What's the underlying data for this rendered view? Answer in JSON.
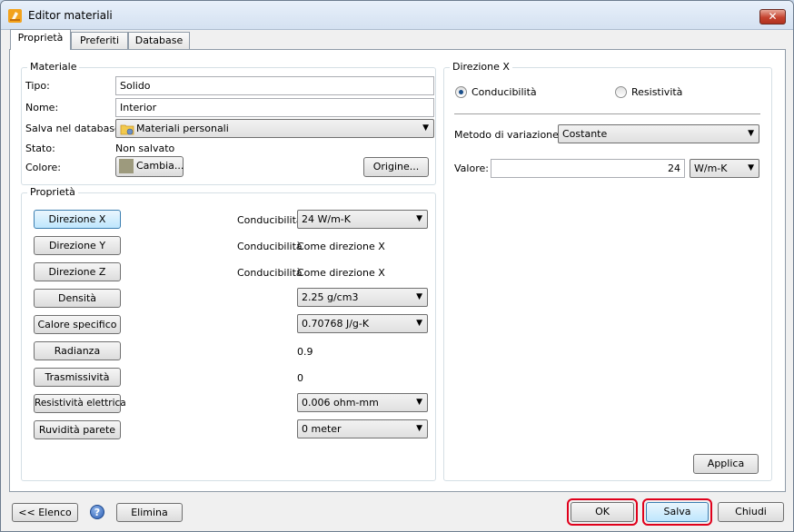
{
  "window": {
    "title": "Editor materiali",
    "close_label": "✕"
  },
  "tabs": [
    {
      "label": "Proprietà",
      "active": true
    },
    {
      "label": "Preferiti",
      "active": false
    },
    {
      "label": "Database",
      "active": false
    }
  ],
  "materiale": {
    "group_title": "Materiale",
    "tipo_label": "Tipo:",
    "tipo_value": "Solido",
    "nome_label": "Nome:",
    "nome_value": "Interior",
    "database_label": "Salva nel database:",
    "database_value": "Materiali personali",
    "stato_label": "Stato:",
    "stato_value": "Non salvato",
    "colore_label": "Colore:",
    "cambia_label": "Cambia...",
    "swatch_color": "#9d9a7d",
    "origine_label": "Origine..."
  },
  "proprieta": {
    "group_title": "Proprietà",
    "rows": [
      {
        "button": "Direzione X",
        "selected": true,
        "caption": "Conducibilità",
        "value": "24 W/m-K",
        "kind": "combo"
      },
      {
        "button": "Direzione Y",
        "selected": false,
        "caption": "Conducibilità",
        "value": "Come direzione X",
        "kind": "text"
      },
      {
        "button": "Direzione Z",
        "selected": false,
        "caption": "Conducibilità",
        "value": "Come direzione X",
        "kind": "text"
      },
      {
        "button": "Densità",
        "selected": false,
        "caption": "",
        "value": "2.25 g/cm3",
        "kind": "combo"
      },
      {
        "button": "Calore specifico",
        "selected": false,
        "caption": "",
        "value": "0.70768 J/g-K",
        "kind": "combo"
      },
      {
        "button": "Radianza",
        "selected": false,
        "caption": "",
        "value": "0.9",
        "kind": "text"
      },
      {
        "button": "Trasmissività",
        "selected": false,
        "caption": "",
        "value": "0",
        "kind": "text"
      },
      {
        "button": "Resistività elettrica",
        "selected": false,
        "caption": "",
        "value": "0.006 ohm-mm",
        "kind": "combo"
      },
      {
        "button": "Ruvidità parete",
        "selected": false,
        "caption": "",
        "value": "0 meter",
        "kind": "combo"
      }
    ]
  },
  "direzione": {
    "group_title": "Direzione X",
    "radio_conducibilita": "Conducibilità",
    "radio_resistivita": "Resistività",
    "selected_radio": "Conducibilità",
    "metodo_label": "Metodo di variazione:",
    "metodo_value": "Costante",
    "valore_label": "Valore:",
    "valore_value": "24",
    "unit_value": "W/m-K",
    "applica_label": "Applica"
  },
  "footer": {
    "elenco_label": "<< Elenco",
    "help_label": "?",
    "elimina_label": "Elimina",
    "ok_label": "OK",
    "salva_label": "Salva",
    "chiudi_label": "Chiudi"
  },
  "colors": {
    "highlight": "#e0001b",
    "accent": "#3c7fb1"
  }
}
